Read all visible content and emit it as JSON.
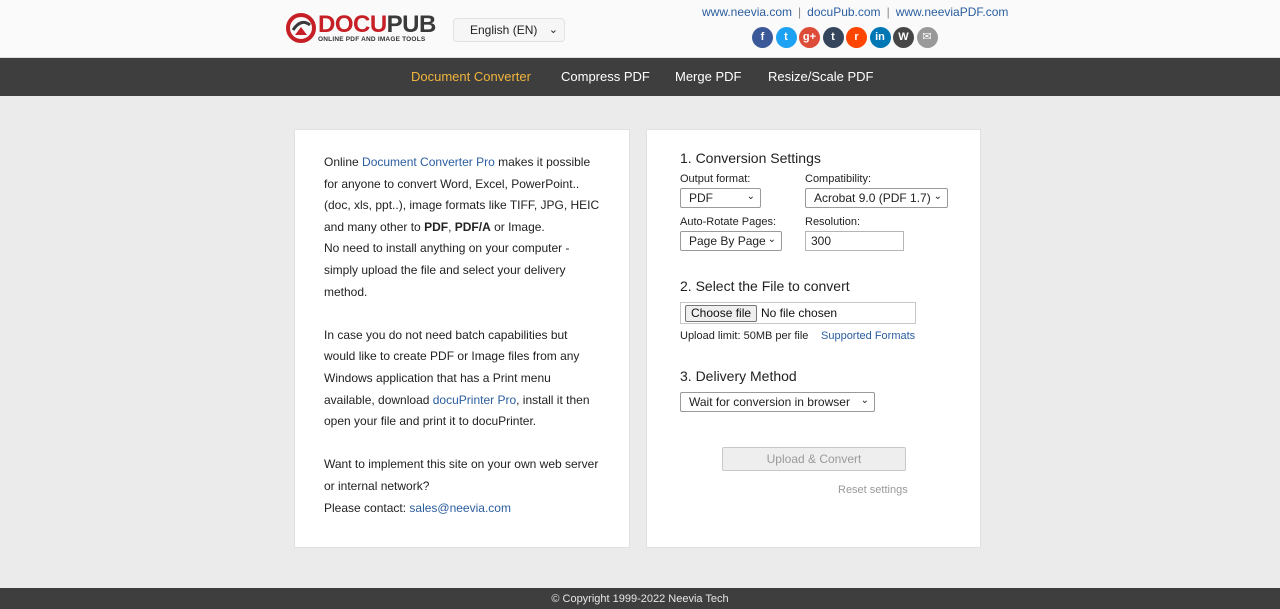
{
  "header": {
    "logo": {
      "title_part1": "DOCU",
      "title_part2": "PUB",
      "subtitle": "ONLINE PDF AND IMAGE TOOLS"
    },
    "language_select": {
      "value": "English (EN)"
    },
    "links": [
      "www.neevia.com",
      "docuPub.com",
      "www.neeviaPDF.com"
    ],
    "social_icons": [
      {
        "name": "facebook-icon",
        "glyph": "f",
        "color": "#3b5998"
      },
      {
        "name": "twitter-icon",
        "glyph": "t",
        "color": "#1da1f2"
      },
      {
        "name": "google-plus-icon",
        "glyph": "g+",
        "color": "#dd4b39"
      },
      {
        "name": "tumblr-icon",
        "glyph": "t",
        "color": "#35465c"
      },
      {
        "name": "reddit-icon",
        "glyph": "r",
        "color": "#ff4500"
      },
      {
        "name": "linkedin-icon",
        "glyph": "in",
        "color": "#0077b5"
      },
      {
        "name": "wordpress-icon",
        "glyph": "W",
        "color": "#464646"
      },
      {
        "name": "email-icon",
        "glyph": "✉",
        "color": "#999999"
      }
    ]
  },
  "nav": {
    "items": [
      {
        "label": "Document Converter",
        "active": true
      },
      {
        "label": "Compress PDF",
        "active": false
      },
      {
        "label": "Merge PDF",
        "active": false
      },
      {
        "label": "Resize/Scale PDF",
        "active": false
      }
    ]
  },
  "intro": {
    "p1_prefix": "Online ",
    "p1_link": "Document Converter Pro",
    "p1_line1_suffix": " makes it possible",
    "p1_line2": "for anyone to convert Word, Excel, PowerPoint..",
    "p1_line3": "(doc, xls, ppt..), image formats like TIFF, JPG, HEIC",
    "p1_line4_prefix": "and many other to ",
    "p1_bold1": "PDF",
    "p1_comma": ", ",
    "p1_bold2": "PDF/A",
    "p1_line4_suffix": " or Image.",
    "p1_line5": "No need to install anything on your computer -",
    "p1_line6": "simply upload the file and select your delivery",
    "p1_line7": "method.",
    "p2_line1": "In case you do not need batch capabilities but",
    "p2_line2": "would like to create PDF or Image files from any",
    "p2_line3": "Windows application that has a Print menu",
    "p2_line4_prefix": "available, download ",
    "p2_link": "docuPrinter Pro",
    "p2_line4_suffix": ", install it then",
    "p2_line5": "open your file and print it to docuPrinter.",
    "p3_line1": "Want to implement this site on your own web server",
    "p3_line2": "or internal network?",
    "p3_line3_prefix": "Please contact: ",
    "p3_email": "sales@neevia.com"
  },
  "settings": {
    "section1_title": "1. Conversion Settings",
    "output_format_label": "Output format:",
    "output_format_value": "PDF",
    "compatibility_label": "Compatibility:",
    "compatibility_value": "Acrobat 9.0 (PDF 1.7)",
    "auto_rotate_label": "Auto-Rotate Pages:",
    "auto_rotate_value": "Page By Page",
    "resolution_label": "Resolution:",
    "resolution_value": "300",
    "section2_title": "2. Select the File to convert",
    "choose_file_label": "Choose file",
    "file_status": "No file chosen",
    "upload_limit": "Upload limit: 50MB per file",
    "supported_formats": "Supported Formats",
    "section3_title": "3. Delivery Method",
    "delivery_value": "Wait for conversion in browser",
    "convert_button": "Upload & Convert",
    "reset_link": "Reset settings"
  },
  "footer": {
    "copyright": "© Copyright 1999-2022 Neevia Tech"
  }
}
